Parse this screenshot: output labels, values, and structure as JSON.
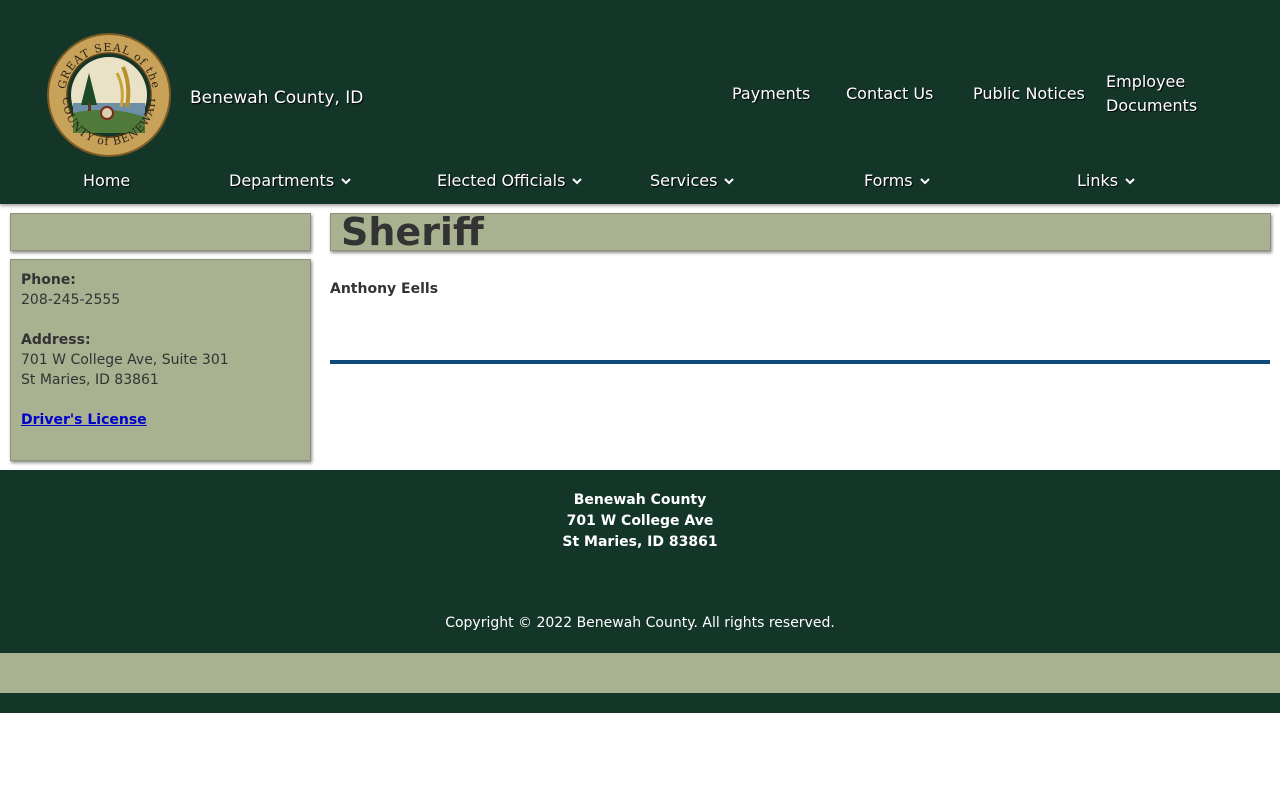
{
  "header": {
    "site_name": "Benewah County, ID",
    "logo_icon": "county-seal-icon",
    "seal_text_top": "GREAT SEAL of the",
    "seal_text_bottom": "COUNTY of BENEWAH",
    "utility_links": [
      "Payments",
      "Contact Us",
      "Public Notices",
      "Employee Documents"
    ]
  },
  "nav": {
    "items": [
      {
        "label": "Home",
        "has_dropdown": false
      },
      {
        "label": "Departments",
        "has_dropdown": true
      },
      {
        "label": "Elected Officials",
        "has_dropdown": true
      },
      {
        "label": "Services",
        "has_dropdown": true
      },
      {
        "label": "Forms",
        "has_dropdown": true
      },
      {
        "label": "Links",
        "has_dropdown": true
      }
    ],
    "dropdown_icon": "chevron-down-icon"
  },
  "sidebar": {
    "phone_label": "Phone:",
    "phone": "208-245-2555",
    "address_label": "Address:",
    "address_line1": "701 W College Ave, Suite 301",
    "address_line2": "St Maries, ID 83861",
    "link": "Driver's License"
  },
  "main": {
    "title": "Sheriff",
    "sheriff_name": "Anthony Eells"
  },
  "footer": {
    "org": "Benewah County",
    "street": "701 W College Ave",
    "city": "St Maries, ID 83861",
    "copyright": "Copyright © 2022 Benewah County. All rights reserved."
  },
  "colors": {
    "header_bg": "#143628",
    "panel_bg": "#a8b190",
    "rule": "#0f4a7a",
    "link": "#0000cc"
  }
}
